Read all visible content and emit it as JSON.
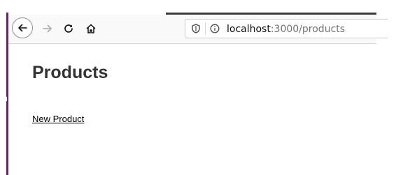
{
  "browser": {
    "url_host": "localhost",
    "url_rest": ":3000/products",
    "icons": {
      "back": "arrow-left-icon",
      "forward": "arrow-right-icon",
      "reload": "reload-icon",
      "home": "home-icon",
      "shield": "shield-icon",
      "info": "info-icon"
    }
  },
  "page": {
    "title": "Products",
    "new_link": "New Product"
  },
  "colors": {
    "accent_edge": "#6b1f66",
    "title": "#333333",
    "link": "#000000"
  }
}
